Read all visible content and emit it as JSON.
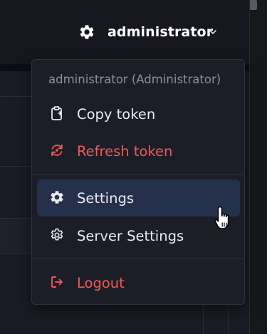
{
  "topbar": {
    "username": "administrator",
    "icon": "gear-icon",
    "chevron": "chevron-down-icon"
  },
  "user_menu": {
    "header": "administrator (Administrator)",
    "items": [
      {
        "label": "Copy token",
        "icon": "clipboard-icon",
        "color": "#e9ebf0"
      },
      {
        "label": "Refresh token",
        "icon": "refresh-icon",
        "color": "#ef5858"
      },
      {
        "label": "Settings",
        "icon": "gear-icon",
        "color": "#e9ebf0",
        "highlighted": true
      },
      {
        "label": "Server Settings",
        "icon": "gear-outline-icon",
        "color": "#e9ebf0"
      },
      {
        "label": "Logout",
        "icon": "logout-icon",
        "color": "#ef5858"
      }
    ]
  },
  "colors": {
    "background": "#16171f",
    "menu_background": "#1c1e27",
    "highlight": "#25304a",
    "danger": "#ef5858",
    "muted": "#8a8f9e"
  }
}
